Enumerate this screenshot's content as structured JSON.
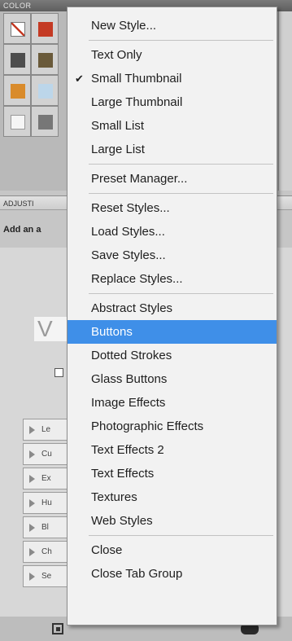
{
  "color_panel": {
    "tab_label": "COLOR",
    "swatches": [
      {
        "name": "red-diagonal-swatch",
        "color": "#ffffff"
      },
      {
        "name": "red-swatch",
        "color": "#c43a24"
      },
      {
        "name": "dark-gray-swatch",
        "color": "#4d4d4d"
      },
      {
        "name": "brown-swatch",
        "color": "#6a5a3a"
      },
      {
        "name": "orange-swatch",
        "color": "#d98b2b"
      },
      {
        "name": "light-blue-swatch",
        "color": "#bcd6ea"
      },
      {
        "name": "white-swatch",
        "color": "#f5f5f5"
      },
      {
        "name": "gray-swatch",
        "color": "#777777"
      }
    ]
  },
  "adjust_panel": {
    "tab_label": "ADJUSTI",
    "hint_text": "Add an a",
    "big_glyph": "V",
    "preset_abbrevs": [
      "Le",
      "Cu",
      "Ex",
      "Hu",
      "Bl",
      "Ch",
      "Se"
    ]
  },
  "menu": {
    "accent_color": "#3f8fe8",
    "groups": [
      [
        {
          "label": "New Style..."
        }
      ],
      [
        {
          "label": "Text Only"
        },
        {
          "label": "Small Thumbnail",
          "checked": true
        },
        {
          "label": "Large Thumbnail"
        },
        {
          "label": "Small List"
        },
        {
          "label": "Large List"
        }
      ],
      [
        {
          "label": "Preset Manager..."
        }
      ],
      [
        {
          "label": "Reset Styles..."
        },
        {
          "label": "Load Styles..."
        },
        {
          "label": "Save Styles..."
        },
        {
          "label": "Replace Styles..."
        }
      ],
      [
        {
          "label": "Abstract Styles"
        },
        {
          "label": "Buttons",
          "highlighted": true
        },
        {
          "label": "Dotted Strokes"
        },
        {
          "label": "Glass Buttons"
        },
        {
          "label": "Image Effects"
        },
        {
          "label": "Photographic Effects"
        },
        {
          "label": "Text Effects 2"
        },
        {
          "label": "Text Effects"
        },
        {
          "label": "Textures"
        },
        {
          "label": "Web Styles"
        }
      ],
      [
        {
          "label": "Close"
        },
        {
          "label": "Close Tab Group"
        }
      ]
    ]
  }
}
